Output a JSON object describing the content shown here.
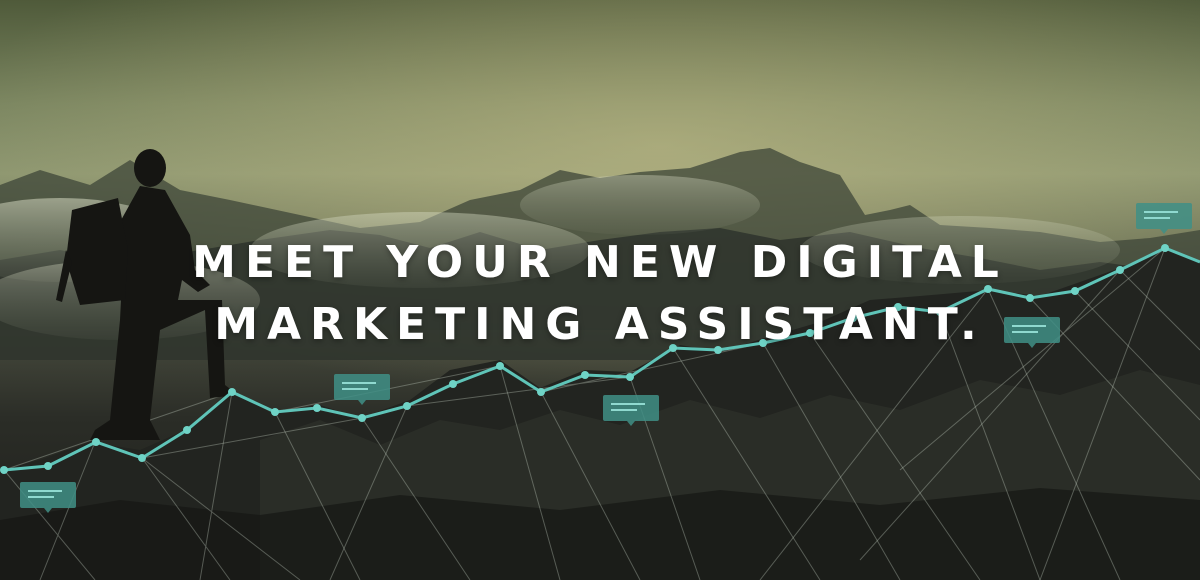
{
  "headline": {
    "line1": "MEET YOUR NEW DIGITAL",
    "line2": "MARKETING ASSISTANT."
  },
  "colors": {
    "accent": "#5fc4b8",
    "bubble": "#3f8f86",
    "sky_top": "#4f5a3a",
    "sky_glow": "#8d9670",
    "rock": "#1e1f1b"
  },
  "decor": {
    "chart_overlay": "upward-trend-line",
    "figure": "hiker-silhouette-with-backpack",
    "network": "low-poly-mesh-lines"
  }
}
